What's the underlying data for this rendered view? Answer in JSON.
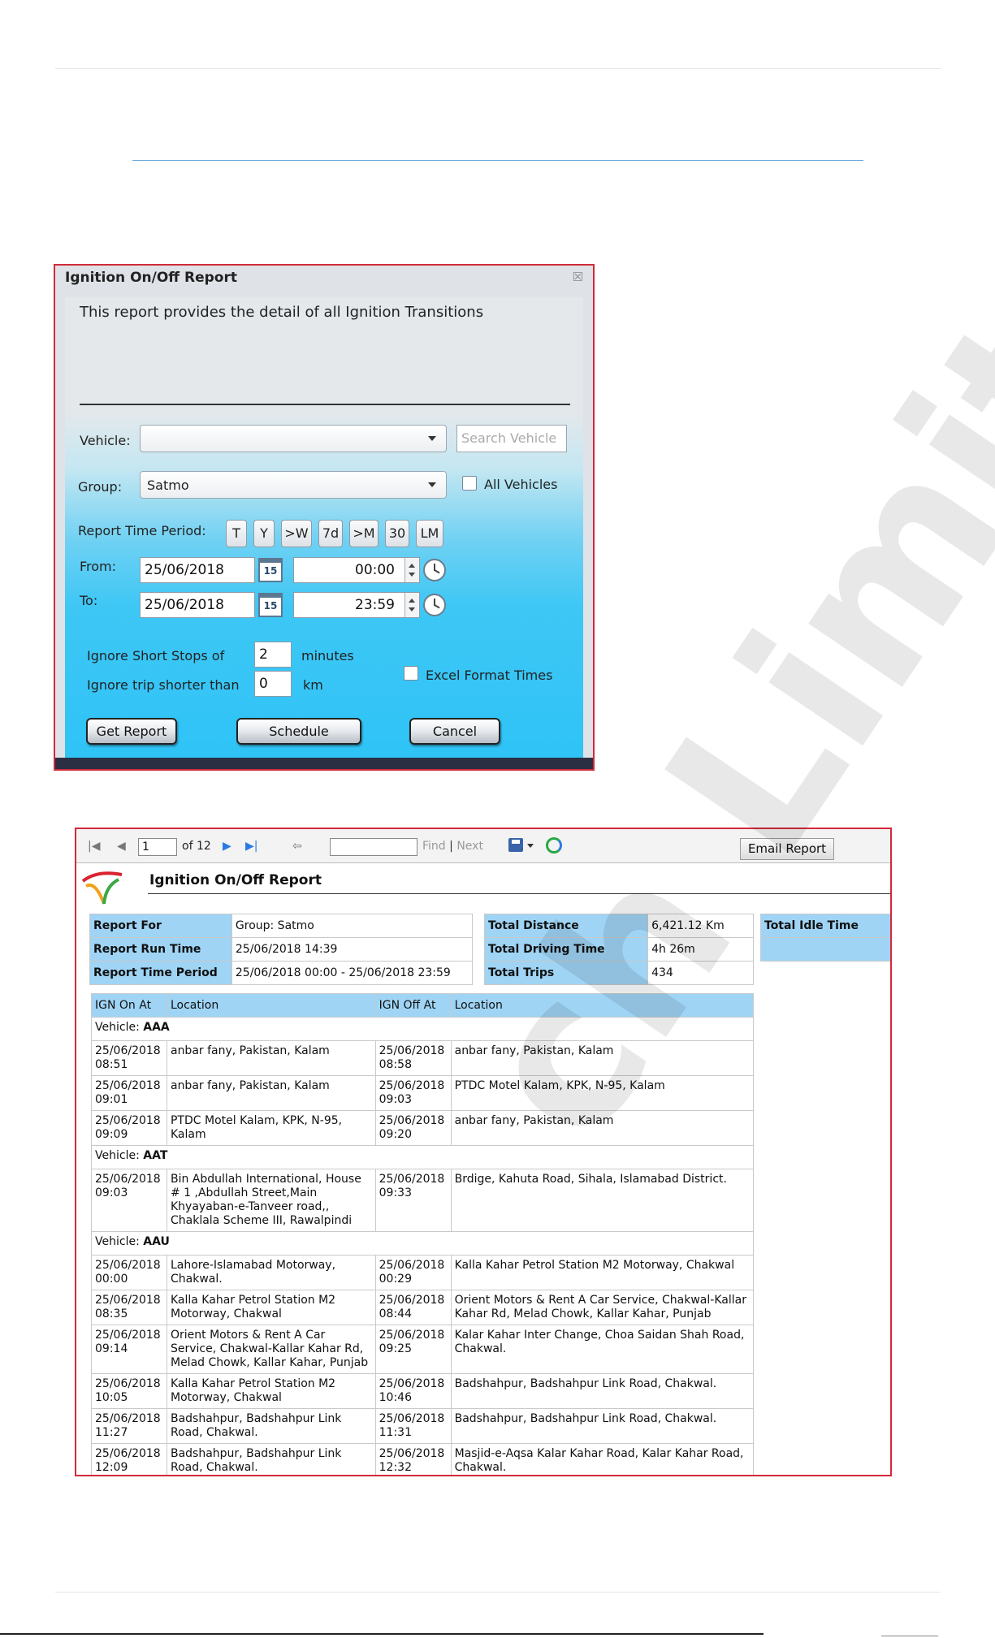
{
  "dialog": {
    "title": "Ignition On/Off Report",
    "close_icon": "close-icon",
    "description": "This report provides the detail of all Ignition Transitions",
    "vehicle_label": "Vehicle:",
    "vehicle_value": "",
    "search_placeholder": "Search Vehicle",
    "group_label": "Group:",
    "group_value": "Satmo",
    "all_vehicles_label": "All Vehicles",
    "period_label": "Report Time Period:",
    "period_buttons": [
      "T",
      "Y",
      ">W",
      "7d",
      ">M",
      "30",
      "LM"
    ],
    "from_label": "From:",
    "from_date": "25/06/2018",
    "from_time": "00:00",
    "to_label": "To:",
    "to_date": "25/06/2018",
    "to_time": "23:59",
    "calendar_day": "15",
    "ignore_stops_label": "Ignore Short Stops of",
    "ignore_stops_value": "2",
    "ignore_stops_unit": "minutes",
    "ignore_trip_label": "Ignore trip shorter than",
    "ignore_trip_value": "0",
    "ignore_trip_unit": "km",
    "excel_label": "Excel Format Times",
    "get_report": "Get Report",
    "schedule": "Schedule",
    "cancel": "Cancel"
  },
  "report": {
    "toolbar": {
      "page": "1",
      "of_pages": "of 12",
      "find": "Find",
      "separator": "|",
      "next": "Next",
      "email": "Email Report"
    },
    "title": "Ignition On/Off Report",
    "summary_left": [
      {
        "k": "Report For",
        "v": "Group: Satmo"
      },
      {
        "k": "Report Run Time",
        "v": "25/06/2018 14:39"
      },
      {
        "k": "Report Time Period",
        "v": "25/06/2018 00:00 - 25/06/2018 23:59"
      }
    ],
    "summary_mid": [
      {
        "k": "Total Distance",
        "v": "6,421.12 Km"
      },
      {
        "k": "Total Driving Time",
        "v": "4h 26m"
      },
      {
        "k": "Total Trips",
        "v": "434"
      }
    ],
    "summary_right": {
      "k": "Total Idle Time",
      "v": ""
    },
    "columns": [
      "IGN On At",
      "Location",
      "IGN Off At",
      "Location"
    ],
    "vehicle_prefix": "Vehicle:",
    "groups": [
      {
        "vehicle": "AAA",
        "rows": [
          [
            "25/06/2018 08:51",
            "anbar fany, Pakistan, Kalam",
            "25/06/2018 08:58",
            "anbar fany, Pakistan, Kalam"
          ],
          [
            "25/06/2018 09:01",
            "anbar fany, Pakistan, Kalam",
            "25/06/2018 09:03",
            "PTDC Motel Kalam, KPK, N-95, Kalam"
          ],
          [
            "25/06/2018 09:09",
            "PTDC Motel Kalam, KPK, N-95, Kalam",
            "25/06/2018 09:20",
            "anbar fany, Pakistan, Kalam"
          ]
        ]
      },
      {
        "vehicle": "AAT",
        "rows": [
          [
            "25/06/2018 09:03",
            "Bin Abdullah International, House # 1 ,Abdullah Street,Main Khyayaban-e-Tanveer road,, Chaklala Scheme III, Rawalpindi",
            "25/06/2018 09:33",
            "Brdige, Kahuta Road, Sihala, Islamabad District."
          ]
        ]
      },
      {
        "vehicle": "AAU",
        "rows": [
          [
            "25/06/2018 00:00",
            "Lahore-Islamabad Motorway, Chakwal.",
            "25/06/2018 00:29",
            "Kalla Kahar Petrol Station M2 Motorway, Chakwal"
          ],
          [
            "25/06/2018 08:35",
            "Kalla Kahar Petrol Station M2 Motorway, Chakwal",
            "25/06/2018 08:44",
            "Orient Motors & Rent A Car Service, Chakwal-Kallar Kahar Rd, Melad Chowk, Kallar Kahar, Punjab"
          ],
          [
            "25/06/2018 09:14",
            "Orient Motors & Rent A Car Service, Chakwal-Kallar Kahar Rd, Melad Chowk, Kallar Kahar, Punjab",
            "25/06/2018 09:25",
            "Kalar Kahar Inter Change, Choa Saidan Shah Road, Chakwal."
          ],
          [
            "25/06/2018 10:05",
            "Kalla Kahar Petrol Station M2 Motorway, Chakwal",
            "25/06/2018 10:46",
            "Badshahpur, Badshahpur Link Road, Chakwal."
          ],
          [
            "25/06/2018 11:27",
            "Badshahpur, Badshahpur Link Road, Chakwal.",
            "25/06/2018 11:31",
            "Badshahpur, Badshahpur Link Road, Chakwal."
          ],
          [
            "25/06/2018 12:09",
            "Badshahpur, Badshahpur Link Road, Chakwal.",
            "25/06/2018 12:32",
            "Masjid-e-Aqsa Kalar Kahar Road, Kalar Kahar Road, Chakwal."
          ]
        ]
      }
    ]
  },
  "watermark": "ch Limited",
  "colors": {
    "frame": "#d22a3a",
    "header_blue": "#9fd4f5",
    "dialog_blue": "#2fc3f6"
  }
}
